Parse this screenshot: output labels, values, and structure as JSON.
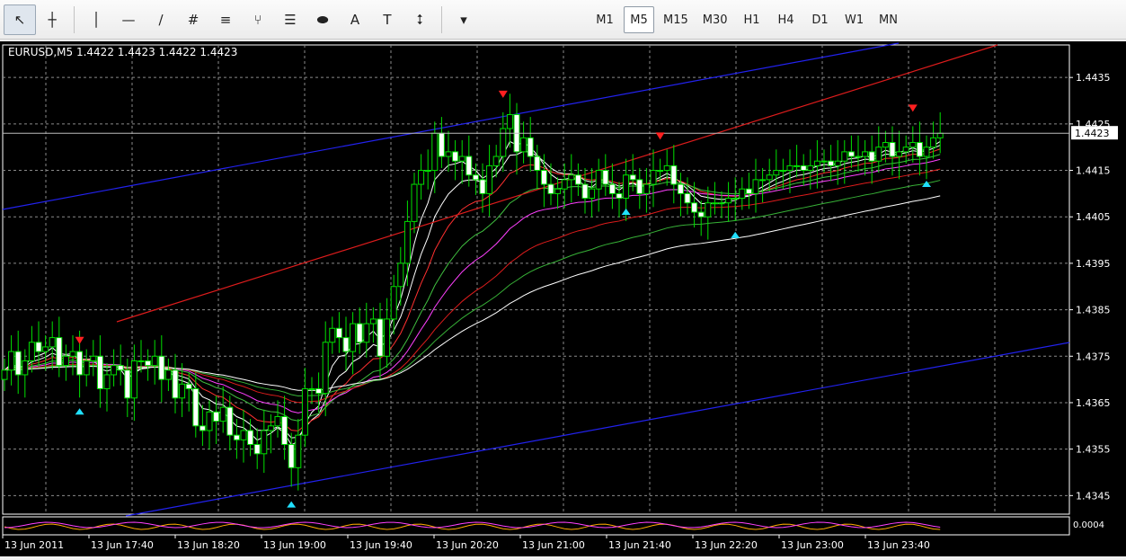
{
  "toolbar": {
    "tools": [
      {
        "name": "cursor-icon",
        "glyph": "↖",
        "active": true
      },
      {
        "name": "crosshair-icon",
        "glyph": "┼"
      },
      {
        "name": "vertical-line-icon",
        "glyph": "│"
      },
      {
        "name": "horizontal-line-icon",
        "glyph": "—"
      },
      {
        "name": "trendline-icon",
        "glyph": "∕"
      },
      {
        "name": "equidistant-channel-icon",
        "glyph": "#"
      },
      {
        "name": "gann-fan-icon",
        "glyph": "≡"
      },
      {
        "name": "fibo-fan-icon",
        "glyph": "⑂"
      },
      {
        "name": "fibo-retracement-icon",
        "glyph": "☰"
      },
      {
        "name": "ellipse-icon",
        "glyph": "⬬"
      },
      {
        "name": "text-icon",
        "glyph": "A"
      },
      {
        "name": "text-label-icon",
        "glyph": "T"
      },
      {
        "name": "arrows-icon",
        "glyph": "⭥"
      },
      {
        "name": "dropdown-chevron-icon",
        "glyph": "▾"
      }
    ],
    "timeframes": [
      "M1",
      "M5",
      "M15",
      "M30",
      "H1",
      "H4",
      "D1",
      "W1",
      "MN"
    ],
    "active_timeframe": "M5"
  },
  "chart_title": "EURUSD,M5  1.4422 1.4423 1.4422 1.4423",
  "indicator_label": "0.0004",
  "chart_data": {
    "type": "candlestick",
    "symbol": "EURUSD",
    "timeframe": "M5",
    "ohlc_header": [
      1.4422,
      1.4423,
      1.4422,
      1.4423
    ],
    "current_price": "1.4423",
    "ylim": [
      1.4341,
      1.4442
    ],
    "y_ticks": [
      "1.4435",
      "1.4425",
      "1.4415",
      "1.4405",
      "1.4395",
      "1.4385",
      "1.4375",
      "1.4365",
      "1.4355",
      "1.4345"
    ],
    "x_ticks": [
      "13 Jun 2011",
      "13 Jun 17:40",
      "13 Jun 18:20",
      "13 Jun 19:00",
      "13 Jun 19:40",
      "13 Jun 20:20",
      "13 Jun 21:00",
      "13 Jun 21:40",
      "13 Jun 22:20",
      "13 Jun 23:00",
      "13 Jun 23:40"
    ],
    "closes": [
      1.4372,
      1.4376,
      1.4371,
      1.4374,
      1.4378,
      1.4376,
      1.4377,
      1.4379,
      1.4373,
      1.4375,
      1.4376,
      1.4371,
      1.4374,
      1.4375,
      1.4368,
      1.4371,
      1.4373,
      1.4372,
      1.4366,
      1.4374,
      1.4374,
      1.4373,
      1.4375,
      1.437,
      1.4372,
      1.4366,
      1.4369,
      1.4368,
      1.436,
      1.4359,
      1.4363,
      1.4361,
      1.4364,
      1.4358,
      1.4357,
      1.4359,
      1.4356,
      1.4354,
      1.4359,
      1.436,
      1.4362,
      1.4356,
      1.4351,
      1.4358,
      1.4368,
      1.4368,
      1.4367,
      1.4378,
      1.4381,
      1.4379,
      1.4376,
      1.4382,
      1.4378,
      1.4382,
      1.4383,
      1.4375,
      1.4383,
      1.439,
      1.4395,
      1.4404,
      1.4412,
      1.4415,
      1.4415,
      1.4423,
      1.4418,
      1.4419,
      1.4417,
      1.4418,
      1.4414,
      1.4413,
      1.441,
      1.4416,
      1.4418,
      1.4424,
      1.4427,
      1.4419,
      1.4422,
      1.4418,
      1.4415,
      1.4412,
      1.441,
      1.4411,
      1.4413,
      1.4414,
      1.4412,
      1.4409,
      1.4411,
      1.4415,
      1.4412,
      1.441,
      1.4409,
      1.4414,
      1.4413,
      1.441,
      1.4412,
      1.4415,
      1.4415,
      1.4416,
      1.4412,
      1.441,
      1.4408,
      1.4406,
      1.4405,
      1.4408,
      1.4408,
      1.4408,
      1.4409,
      1.4409,
      1.4411,
      1.441,
      1.4413,
      1.4413,
      1.4414,
      1.4415,
      1.4415,
      1.4416,
      1.4416,
      1.4415,
      1.4416,
      1.4417,
      1.4417,
      1.4416,
      1.4417,
      1.4419,
      1.4418,
      1.4418,
      1.4419,
      1.4417,
      1.442,
      1.4421,
      1.4418,
      1.4419,
      1.442,
      1.4421,
      1.4418,
      1.442,
      1.4422,
      1.4423
    ]
  }
}
